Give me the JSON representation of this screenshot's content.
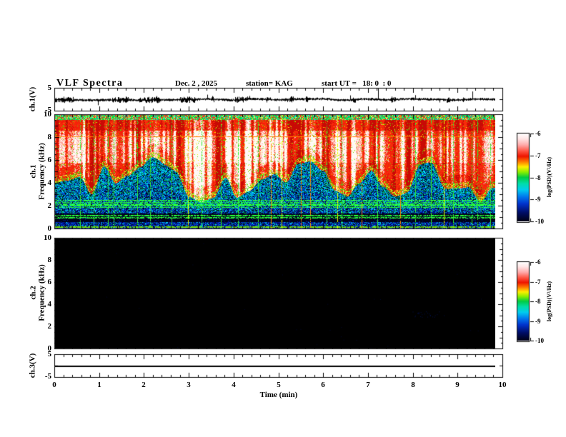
{
  "header": {
    "title": "VLF Spectra",
    "date": "Dec. 2 , 2025",
    "station": "station= KAG",
    "start_ut": "start UT =   18: 0  : 0"
  },
  "time_axis": {
    "label": "Time (min)",
    "tick_labels": [
      "0",
      "1",
      "2",
      "3",
      "4",
      "5",
      "6",
      "7",
      "8",
      "9",
      "10"
    ],
    "minor_per_major": 5,
    "range_min": [
      0,
      10
    ],
    "data_end_min": 9.83
  },
  "panels": [
    {
      "id": "ch1_waveform",
      "ylabel": "ch.1(V)",
      "ytick_labels": [
        "5",
        "-5"
      ],
      "yrange_v": [
        -5,
        5
      ]
    },
    {
      "id": "ch1_spectrogram",
      "ylabel_ch": "ch.1",
      "ylabel_freq": "Frequency (kHz)",
      "ytick_labels": [
        "10",
        "8",
        "6",
        "4",
        "2",
        "0"
      ],
      "yrange_khz": [
        0,
        10
      ]
    },
    {
      "id": "ch2_spectrogram",
      "ylabel_ch": "ch.2",
      "ylabel_freq": "Frequency (kHz)",
      "ytick_labels": [
        "10",
        "8",
        "6",
        "4",
        "2",
        "0"
      ],
      "yrange_khz": [
        0,
        10
      ]
    },
    {
      "id": "ch3_waveform",
      "ylabel": "ch.3(V)",
      "ytick_labels": [
        "5",
        "-5"
      ],
      "yrange_v": [
        -5,
        5
      ]
    }
  ],
  "colorbars": [
    {
      "for": "ch1_spectrogram",
      "tick_labels": [
        "-6",
        "-7",
        "-8",
        "-9",
        "-10"
      ],
      "label": "log(PSD)(V²/Hz)",
      "gradient_top_to_bottom": [
        [
          "0",
          "#ffffff"
        ],
        [
          "0.06",
          "#ffe6e6"
        ],
        [
          "0.13",
          "#ffaaaa"
        ],
        [
          "0.20",
          "#ff5544"
        ],
        [
          "0.26",
          "#ee1500"
        ],
        [
          "0.32",
          "#ff7700"
        ],
        [
          "0.38",
          "#ffee00"
        ],
        [
          "0.44",
          "#88ee00"
        ],
        [
          "0.50",
          "#00cc44"
        ],
        [
          "0.57",
          "#00ddaa"
        ],
        [
          "0.64",
          "#00ccee"
        ],
        [
          "0.72",
          "#0077ee"
        ],
        [
          "0.80",
          "#0033cc"
        ],
        [
          "0.90",
          "#000d66"
        ],
        [
          "1",
          "#000014"
        ]
      ]
    },
    {
      "for": "ch2_spectrogram",
      "tick_labels": [
        "-6",
        "-7",
        "-8",
        "-9",
        "-10"
      ],
      "label": "log(PSD)(V²/Hz)",
      "gradient_top_to_bottom": [
        [
          "0",
          "#ffffff"
        ],
        [
          "0.06",
          "#ffe6e6"
        ],
        [
          "0.13",
          "#ffaaaa"
        ],
        [
          "0.20",
          "#ff5544"
        ],
        [
          "0.26",
          "#ee1500"
        ],
        [
          "0.32",
          "#ff7700"
        ],
        [
          "0.38",
          "#ffee00"
        ],
        [
          "0.44",
          "#88ee00"
        ],
        [
          "0.50",
          "#00cc44"
        ],
        [
          "0.57",
          "#00ddaa"
        ],
        [
          "0.64",
          "#00ccee"
        ],
        [
          "0.72",
          "#0077ee"
        ],
        [
          "0.80",
          "#0033cc"
        ],
        [
          "0.90",
          "#000d66"
        ],
        [
          "1",
          "#000014"
        ]
      ]
    }
  ],
  "chart_data": [
    {
      "type": "line",
      "panel": "ch1_waveform",
      "title": "ch.1 voltage record",
      "xlim_min": [
        0,
        10
      ],
      "data_end_min": 9.83,
      "ylim_v": [
        -5,
        5
      ],
      "yticks": [
        5,
        -5
      ],
      "description": "dense broadband noise of about ±0.5 V around 0 V with impulsive one-sided spikes",
      "noise_v_typ": 0.5,
      "spikes": [
        {
          "t_min": 0.97,
          "v": -2.6
        },
        {
          "t_min": 1.6,
          "v": 1.2
        },
        {
          "t_min": 2.28,
          "v": 1.4
        },
        {
          "t_min": 3.42,
          "v": 2.0
        },
        {
          "t_min": 4.35,
          "v": 1.5
        },
        {
          "t_min": 5.2,
          "v": -1.2
        },
        {
          "t_min": 6.6,
          "v": 1.7
        },
        {
          "t_min": 7.22,
          "v": 4.7
        },
        {
          "t_min": 8.05,
          "v": 1.8
        },
        {
          "t_min": 8.6,
          "v": -1.4
        },
        {
          "t_min": 9.33,
          "v": 3.4
        }
      ]
    },
    {
      "type": "heatmap",
      "panel": "ch1_spectrogram",
      "title": "ch.1 VLF power spectral density",
      "xlim_min": [
        0,
        10
      ],
      "data_end_min": 9.83,
      "flim_khz": [
        0,
        10
      ],
      "yticks": [
        10,
        8,
        6,
        4,
        2,
        0
      ],
      "zscale": "log(PSD)(V²/Hz) from -6 (white) to -10 (black)",
      "features": {
        "top_edge_band_khz": [
          9.55,
          10.0
        ],
        "strong_red_white_region_khz": [
          4.3,
          9.55
        ],
        "orange_horizontal_line_khz": 8.08,
        "red_streak_bottom_wander_khz": [
          3.0,
          5.5
        ],
        "lower_blue_speckle_khz": [
          0,
          4.3
        ],
        "dark_black_band_khz": [
          0.55,
          1.3
        ],
        "green_horizontal_lines_khz": [
          2.45,
          2.3,
          2.15,
          2.0,
          1.85,
          1.15,
          0.95
        ],
        "bottom_edge_line_khz": 0.15,
        "vertical_impulse_lines": "about 35 thin full-height green/yellow/orange sferic lines"
      }
    },
    {
      "type": "heatmap",
      "panel": "ch2_spectrogram",
      "title": "ch.2 VLF power spectral density",
      "xlim_min": [
        0,
        10
      ],
      "data_end_min": 9.83,
      "flim_khz": [
        0,
        10
      ],
      "yticks": [
        10,
        8,
        6,
        4,
        2,
        0
      ],
      "zscale": "log(PSD)(V²/Hz) from -6 (white) to -10 (black)",
      "description": "no signal: uniformly black (log PSD ≈ -10) with sparse faint dark-blue speckles near 8.2-8.6 min around 3 kHz"
    },
    {
      "type": "line",
      "panel": "ch3_waveform",
      "title": "ch.3 voltage record",
      "xlim_min": [
        0,
        10
      ],
      "data_end_min": 9.83,
      "ylim_v": [
        -5,
        5
      ],
      "yticks": [
        5,
        -5
      ],
      "description": "flat line at 0 V for the whole record",
      "value_v": 0
    }
  ]
}
